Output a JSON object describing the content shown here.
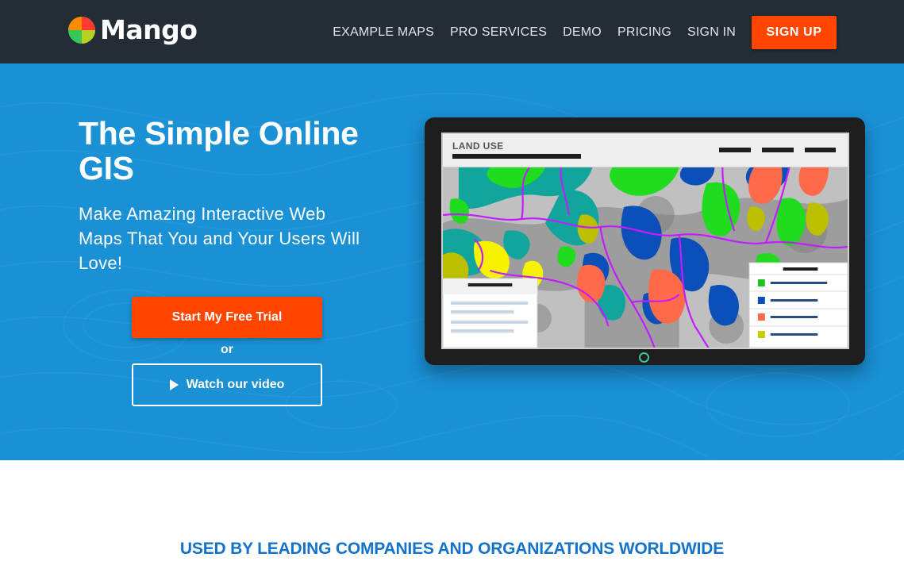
{
  "brand": {
    "name": "Mango",
    "logo_icon": "mango-logo-icon",
    "colors": {
      "green": "#34c759",
      "orange": "#ff7a00",
      "red": "#ff3b30"
    }
  },
  "nav": {
    "items": [
      {
        "label": "EXAMPLE MAPS"
      },
      {
        "label": "PRO SERVICES"
      },
      {
        "label": "DEMO"
      },
      {
        "label": "PRICING"
      },
      {
        "label": "SIGN IN"
      }
    ],
    "signup_label": "SIGN UP"
  },
  "hero": {
    "title": "The Simple Online GIS",
    "subtitle": "Make Amazing Interactive Web Maps That You and Your Users Will Love!",
    "trial_label": "Start My Free Trial",
    "or_label": "or",
    "video_label": "Watch our video",
    "video_icon": "play-icon",
    "background_color": "#1a90d5",
    "accent_color": "#ff4500"
  },
  "device": {
    "screen_title": "LAND USE",
    "legend_colors": [
      "#1fc31f",
      "#0d4fb8",
      "#ff6a4a",
      "#c6cc00"
    ]
  },
  "companies": {
    "heading": "USED BY LEADING COMPANIES AND ORGANIZATIONS WORLDWIDE"
  }
}
